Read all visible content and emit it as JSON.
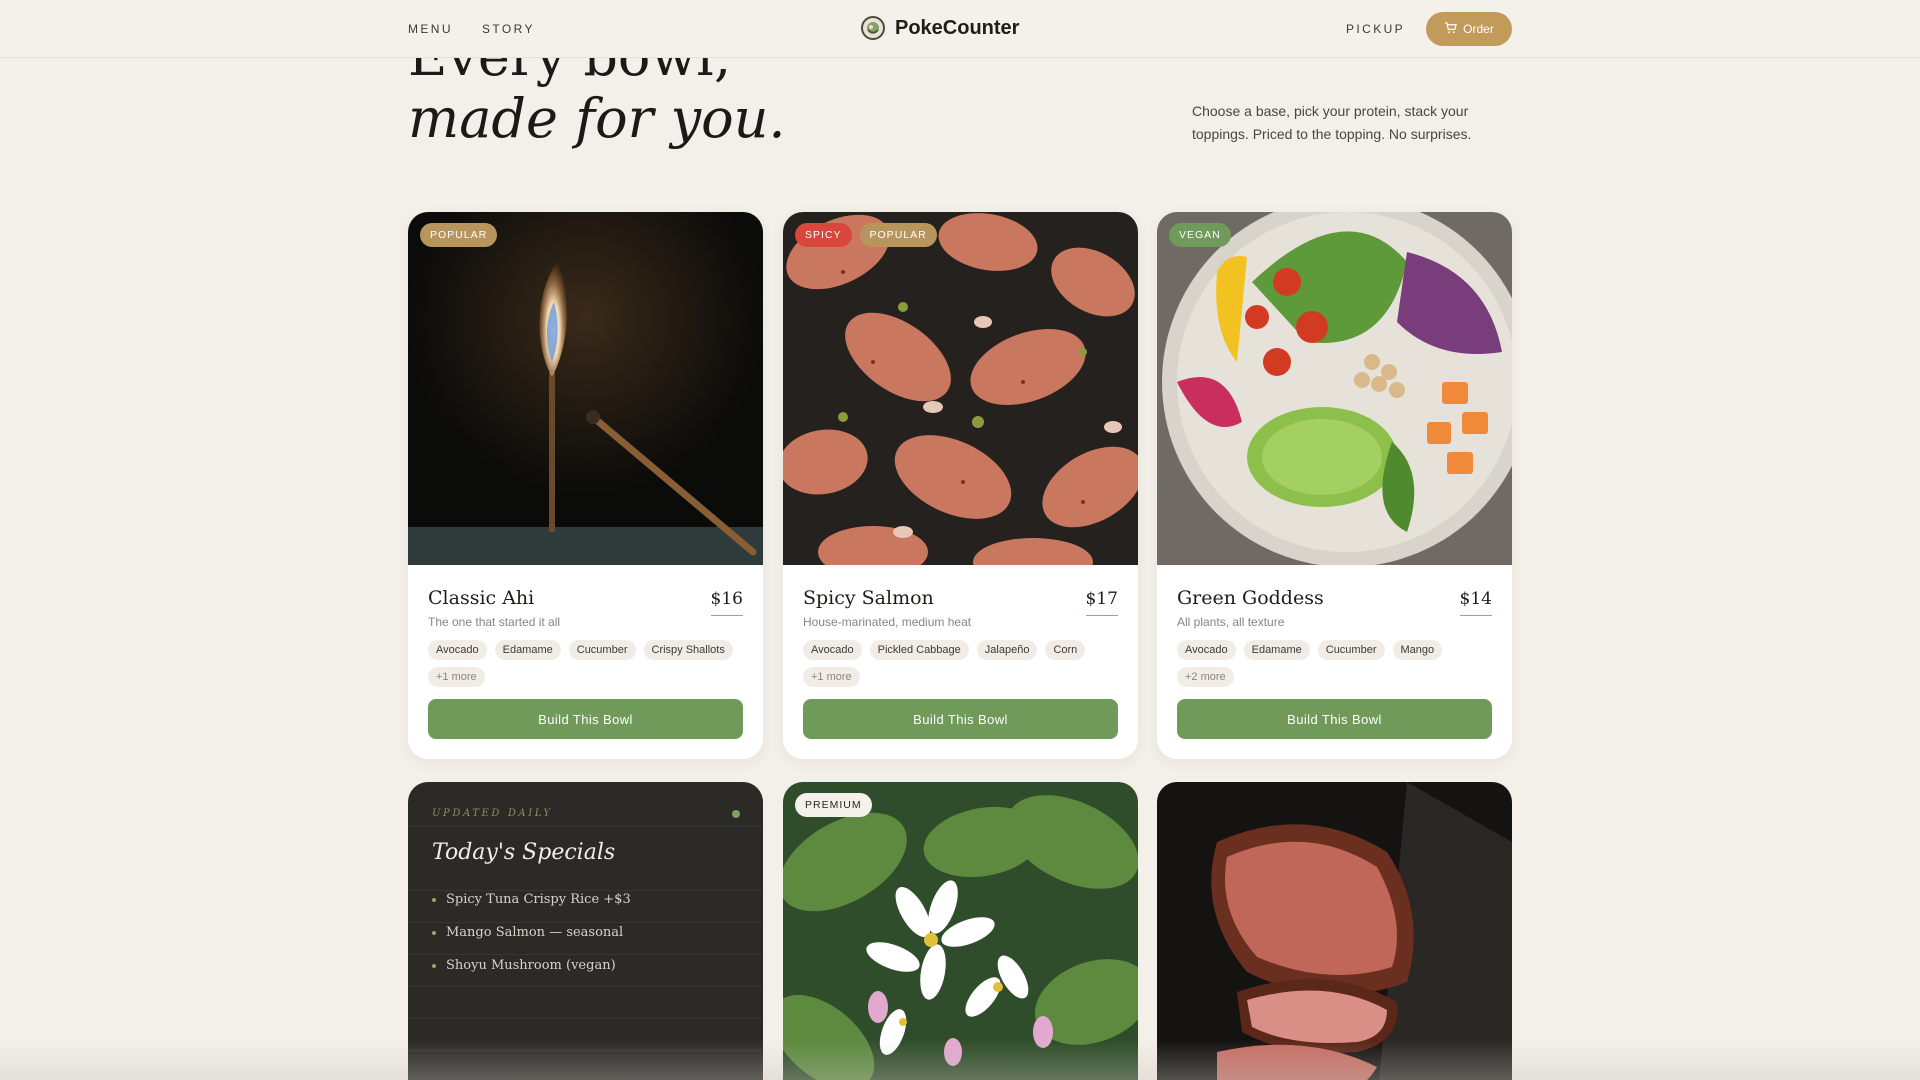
{
  "header": {
    "nav_menu": "MENU",
    "nav_story": "STORY",
    "brand": "PokeCounter",
    "nav_pickup": "PICKUP",
    "order_label": "Order"
  },
  "hero": {
    "title_line1": "Every bowl,",
    "title_line2": "made for you.",
    "description": "Choose a base, pick your protein, stack your toppings. Priced to the topping. No surprises."
  },
  "colors": {
    "accent_gold": "#c29a5a",
    "green_button": "#6f9a59",
    "spicy_badge": "#d9463b",
    "vegan_badge": "#6f9a59",
    "dark_panel": "#2b2a27"
  },
  "cards": [
    {
      "name": "Classic Ahi",
      "subtitle": "The one that started it all",
      "price": "$16",
      "badges": [
        "POPULAR"
      ],
      "tags": [
        "Avocado",
        "Edamame",
        "Cucumber",
        "Crispy Shallots"
      ],
      "more": "+1 more",
      "button": "Build This Bowl",
      "image": "match-flame-photo"
    },
    {
      "name": "Spicy Salmon",
      "subtitle": "House-marinated, medium heat",
      "price": "$17",
      "badges": [
        "SPICY",
        "POPULAR"
      ],
      "tags": [
        "Avocado",
        "Pickled Cabbage",
        "Jalapeño",
        "Corn"
      ],
      "more": "+1 more",
      "button": "Build This Bowl",
      "image": "marinated-drumsticks-photo"
    },
    {
      "name": "Green Goddess",
      "subtitle": "All plants, all texture",
      "price": "$14",
      "badges": [
        "VEGAN"
      ],
      "tags": [
        "Avocado",
        "Edamame",
        "Cucumber",
        "Mango"
      ],
      "more": "+2 more",
      "button": "Build This Bowl",
      "image": "vegetable-bowl-photo"
    }
  ],
  "specials": {
    "kicker": "UPDATED DAILY",
    "title": "Today's Specials",
    "items": [
      "Spicy Tuna Crispy Rice +$3",
      "Mango Salmon — seasonal",
      "Shoyu Mushroom (vegan)"
    ]
  },
  "row2": {
    "premium_badge": "PREMIUM",
    "flower_image": "citrus-blossom-photo",
    "steak_image": "sliced-steak-photo"
  }
}
